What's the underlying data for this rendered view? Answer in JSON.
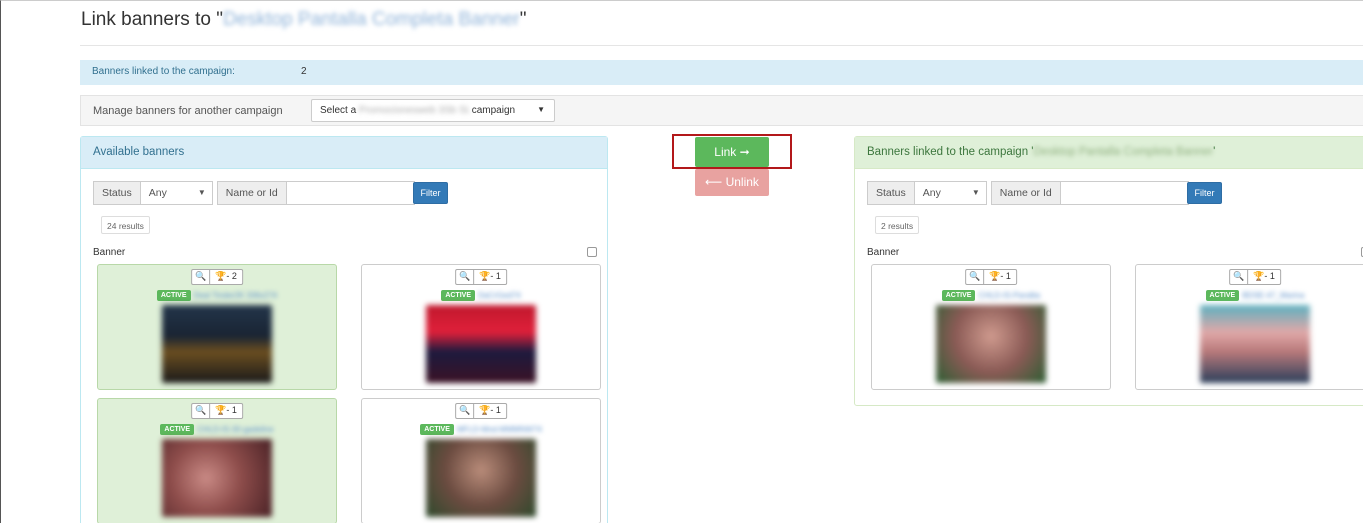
{
  "page": {
    "title_prefix": "Link banners to \"",
    "title_campaign": "Desktop Pantalla Completa Banner",
    "title_suffix": "\""
  },
  "info": {
    "label": "Banners linked to the campaign:",
    "count": "2"
  },
  "manage": {
    "label": "Manage banners for another campaign",
    "select_prefix": "Select a",
    "select_blurred": "Promocionesweb 3Sb SL",
    "select_suffix": "campaign",
    "caret": "▼"
  },
  "available": {
    "heading": "Available banners",
    "filter": {
      "status_label": "Status",
      "status_value": "Any",
      "caret": "▼",
      "name_label": "Name or Id",
      "name_value": "",
      "button": "Filter"
    },
    "results": "24 results",
    "column_header": "Banner",
    "cards": [
      {
        "zoom": "🔍",
        "trophy": "🏆- 2",
        "status": "ACTIVE",
        "name": "Deal Tinder2K 336x274",
        "linked": true
      },
      {
        "zoom": "🔍",
        "trophy": "🏆- 1",
        "status": "ACTIVE",
        "name": "DaCrGed74",
        "linked": false
      },
      {
        "zoom": "🔍",
        "trophy": "🏆- 1",
        "status": "ACTIVE",
        "name": "CHLD-IS-30-gadeline",
        "linked": true
      },
      {
        "zoom": "🔍",
        "trophy": "🏆- 1",
        "status": "ACTIVE",
        "name": "MFLD-Mnd-MMMNW74",
        "linked": false
      }
    ]
  },
  "actions": {
    "link": "Link ➞",
    "unlink": "⟵ Unlink"
  },
  "linked": {
    "heading_prefix": "Banners linked to the campaign '",
    "heading_campaign": "Desktop Pantalla Completa Banner",
    "heading_suffix": "'",
    "filter": {
      "status_label": "Status",
      "status_value": "Any",
      "caret": "▼",
      "name_label": "Name or Id",
      "name_value": "",
      "button": "Filter"
    },
    "results": "2 results",
    "column_header": "Banner",
    "cards": [
      {
        "zoom": "🔍",
        "trophy": "🏆- 1",
        "status": "ACTIVE",
        "name": "CHLD-IS-Pandita"
      },
      {
        "zoom": "🔍",
        "trophy": "🏆- 1",
        "status": "ACTIVE",
        "name": "BDSE-47_Marina"
      }
    ]
  }
}
